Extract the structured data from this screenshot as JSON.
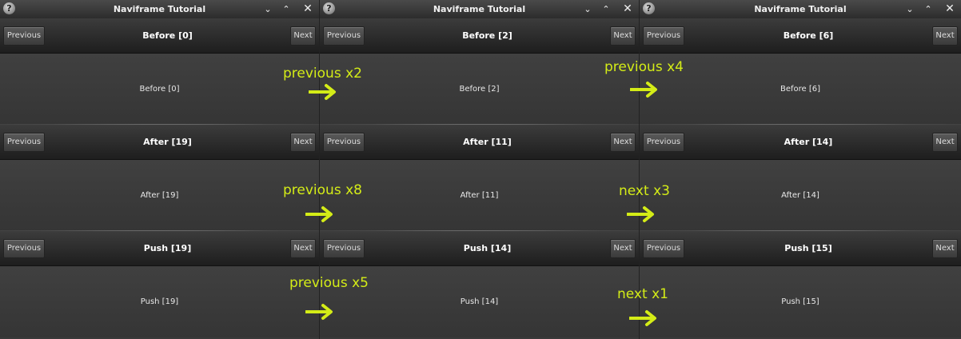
{
  "window_title": "Naviframe Tutorial",
  "prev_label": "Previous",
  "next_label": "Next",
  "windows": [
    {
      "frames": [
        {
          "title": "Before [0]",
          "content": "Before [0]"
        },
        {
          "title": "After [19]",
          "content": "After [19]"
        },
        {
          "title": "Push [19]",
          "content": "Push [19]"
        }
      ]
    },
    {
      "frames": [
        {
          "title": "Before [2]",
          "content": "Before [2]"
        },
        {
          "title": "After [11]",
          "content": "After [11]"
        },
        {
          "title": "Push [14]",
          "content": "Push [14]"
        }
      ]
    },
    {
      "frames": [
        {
          "title": "Before [6]",
          "content": "Before [6]"
        },
        {
          "title": "After [14]",
          "content": "After [14]"
        },
        {
          "title": "Push [15]",
          "content": "Push [15]"
        }
      ]
    }
  ],
  "annotations": {
    "color": "#d4ec17",
    "labels": [
      "previous x2",
      "previous x4",
      "previous x8",
      "next x3",
      "previous x5",
      "next x1"
    ]
  }
}
